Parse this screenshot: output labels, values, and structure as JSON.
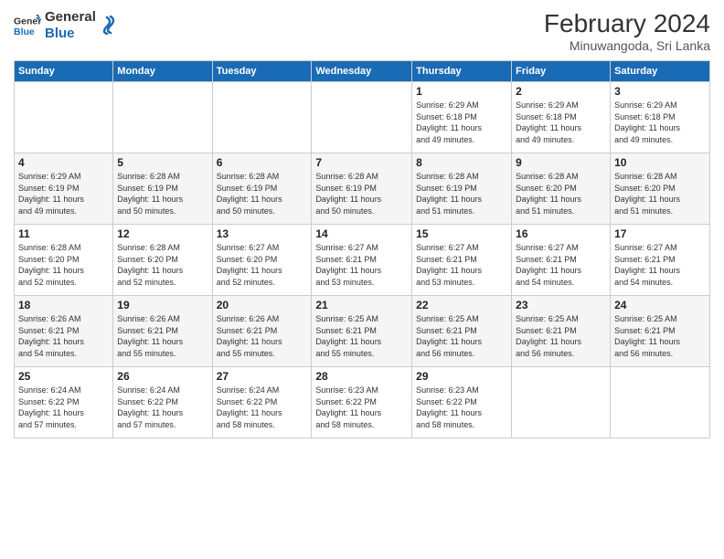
{
  "header": {
    "logo_line1": "General",
    "logo_line2": "Blue",
    "month_year": "February 2024",
    "location": "Minuwangoda, Sri Lanka"
  },
  "days_of_week": [
    "Sunday",
    "Monday",
    "Tuesday",
    "Wednesday",
    "Thursday",
    "Friday",
    "Saturday"
  ],
  "weeks": [
    [
      {
        "day": "",
        "info": ""
      },
      {
        "day": "",
        "info": ""
      },
      {
        "day": "",
        "info": ""
      },
      {
        "day": "",
        "info": ""
      },
      {
        "day": "1",
        "info": "Sunrise: 6:29 AM\nSunset: 6:18 PM\nDaylight: 11 hours\nand 49 minutes."
      },
      {
        "day": "2",
        "info": "Sunrise: 6:29 AM\nSunset: 6:18 PM\nDaylight: 11 hours\nand 49 minutes."
      },
      {
        "day": "3",
        "info": "Sunrise: 6:29 AM\nSunset: 6:18 PM\nDaylight: 11 hours\nand 49 minutes."
      }
    ],
    [
      {
        "day": "4",
        "info": "Sunrise: 6:29 AM\nSunset: 6:19 PM\nDaylight: 11 hours\nand 49 minutes."
      },
      {
        "day": "5",
        "info": "Sunrise: 6:28 AM\nSunset: 6:19 PM\nDaylight: 11 hours\nand 50 minutes."
      },
      {
        "day": "6",
        "info": "Sunrise: 6:28 AM\nSunset: 6:19 PM\nDaylight: 11 hours\nand 50 minutes."
      },
      {
        "day": "7",
        "info": "Sunrise: 6:28 AM\nSunset: 6:19 PM\nDaylight: 11 hours\nand 50 minutes."
      },
      {
        "day": "8",
        "info": "Sunrise: 6:28 AM\nSunset: 6:19 PM\nDaylight: 11 hours\nand 51 minutes."
      },
      {
        "day": "9",
        "info": "Sunrise: 6:28 AM\nSunset: 6:20 PM\nDaylight: 11 hours\nand 51 minutes."
      },
      {
        "day": "10",
        "info": "Sunrise: 6:28 AM\nSunset: 6:20 PM\nDaylight: 11 hours\nand 51 minutes."
      }
    ],
    [
      {
        "day": "11",
        "info": "Sunrise: 6:28 AM\nSunset: 6:20 PM\nDaylight: 11 hours\nand 52 minutes."
      },
      {
        "day": "12",
        "info": "Sunrise: 6:28 AM\nSunset: 6:20 PM\nDaylight: 11 hours\nand 52 minutes."
      },
      {
        "day": "13",
        "info": "Sunrise: 6:27 AM\nSunset: 6:20 PM\nDaylight: 11 hours\nand 52 minutes."
      },
      {
        "day": "14",
        "info": "Sunrise: 6:27 AM\nSunset: 6:21 PM\nDaylight: 11 hours\nand 53 minutes."
      },
      {
        "day": "15",
        "info": "Sunrise: 6:27 AM\nSunset: 6:21 PM\nDaylight: 11 hours\nand 53 minutes."
      },
      {
        "day": "16",
        "info": "Sunrise: 6:27 AM\nSunset: 6:21 PM\nDaylight: 11 hours\nand 54 minutes."
      },
      {
        "day": "17",
        "info": "Sunrise: 6:27 AM\nSunset: 6:21 PM\nDaylight: 11 hours\nand 54 minutes."
      }
    ],
    [
      {
        "day": "18",
        "info": "Sunrise: 6:26 AM\nSunset: 6:21 PM\nDaylight: 11 hours\nand 54 minutes."
      },
      {
        "day": "19",
        "info": "Sunrise: 6:26 AM\nSunset: 6:21 PM\nDaylight: 11 hours\nand 55 minutes."
      },
      {
        "day": "20",
        "info": "Sunrise: 6:26 AM\nSunset: 6:21 PM\nDaylight: 11 hours\nand 55 minutes."
      },
      {
        "day": "21",
        "info": "Sunrise: 6:25 AM\nSunset: 6:21 PM\nDaylight: 11 hours\nand 55 minutes."
      },
      {
        "day": "22",
        "info": "Sunrise: 6:25 AM\nSunset: 6:21 PM\nDaylight: 11 hours\nand 56 minutes."
      },
      {
        "day": "23",
        "info": "Sunrise: 6:25 AM\nSunset: 6:21 PM\nDaylight: 11 hours\nand 56 minutes."
      },
      {
        "day": "24",
        "info": "Sunrise: 6:25 AM\nSunset: 6:21 PM\nDaylight: 11 hours\nand 56 minutes."
      }
    ],
    [
      {
        "day": "25",
        "info": "Sunrise: 6:24 AM\nSunset: 6:22 PM\nDaylight: 11 hours\nand 57 minutes."
      },
      {
        "day": "26",
        "info": "Sunrise: 6:24 AM\nSunset: 6:22 PM\nDaylight: 11 hours\nand 57 minutes."
      },
      {
        "day": "27",
        "info": "Sunrise: 6:24 AM\nSunset: 6:22 PM\nDaylight: 11 hours\nand 58 minutes."
      },
      {
        "day": "28",
        "info": "Sunrise: 6:23 AM\nSunset: 6:22 PM\nDaylight: 11 hours\nand 58 minutes."
      },
      {
        "day": "29",
        "info": "Sunrise: 6:23 AM\nSunset: 6:22 PM\nDaylight: 11 hours\nand 58 minutes."
      },
      {
        "day": "",
        "info": ""
      },
      {
        "day": "",
        "info": ""
      }
    ]
  ]
}
